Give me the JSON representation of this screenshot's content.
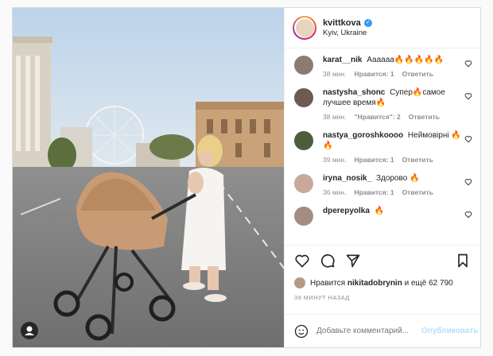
{
  "post": {
    "username": "kvittkova",
    "location": "Kyiv, Ukraine",
    "verified": true
  },
  "comments": [
    {
      "user": "karat__nik",
      "text": "Аааааа🔥🔥🔥🔥🔥",
      "time": "38 мин.",
      "likes": "Нравится: 1",
      "reply": "Ответить",
      "avatar_color": "#8d7b72"
    },
    {
      "user": "nastysha_shonc",
      "text": "Супер🔥самое лучшее время🔥",
      "time": "38 мин.",
      "likes": "\"Нравится\": 2",
      "reply": "Ответить",
      "avatar_color": "#6e5a52"
    },
    {
      "user": "nastya_goroshkoooo",
      "text": "Неймовірні 🔥🔥",
      "time": "39 мин.",
      "likes": "Нравится: 1",
      "reply": "Ответить",
      "avatar_color": "#4b5d3a"
    },
    {
      "user": "iryna_nosik_",
      "text": "Здорово 🔥",
      "time": "36 мин.",
      "likes": "Нравится: 1",
      "reply": "Ответить",
      "avatar_color": "#c9a79a"
    },
    {
      "user": "dperepyolka",
      "text": "🔥",
      "time": "",
      "likes": "",
      "reply": "",
      "avatar_color": "#a38d80"
    }
  ],
  "likes": {
    "prefix": "Нравится",
    "user": "nikitadobrynin",
    "suffix": "и ещё 62 790"
  },
  "time_ago": "39 МИНУТ НАЗАД",
  "add_comment": {
    "placeholder": "Добавьте комментарий...",
    "publish": "Опубликовать"
  },
  "icons": [
    "heart-icon",
    "comment-icon",
    "share-icon",
    "bookmark-icon",
    "emoji-icon",
    "user-tag-icon"
  ],
  "colors": {
    "verified": "#3897f0",
    "publish": "#b2dffc",
    "muted": "#8e8e8e"
  }
}
